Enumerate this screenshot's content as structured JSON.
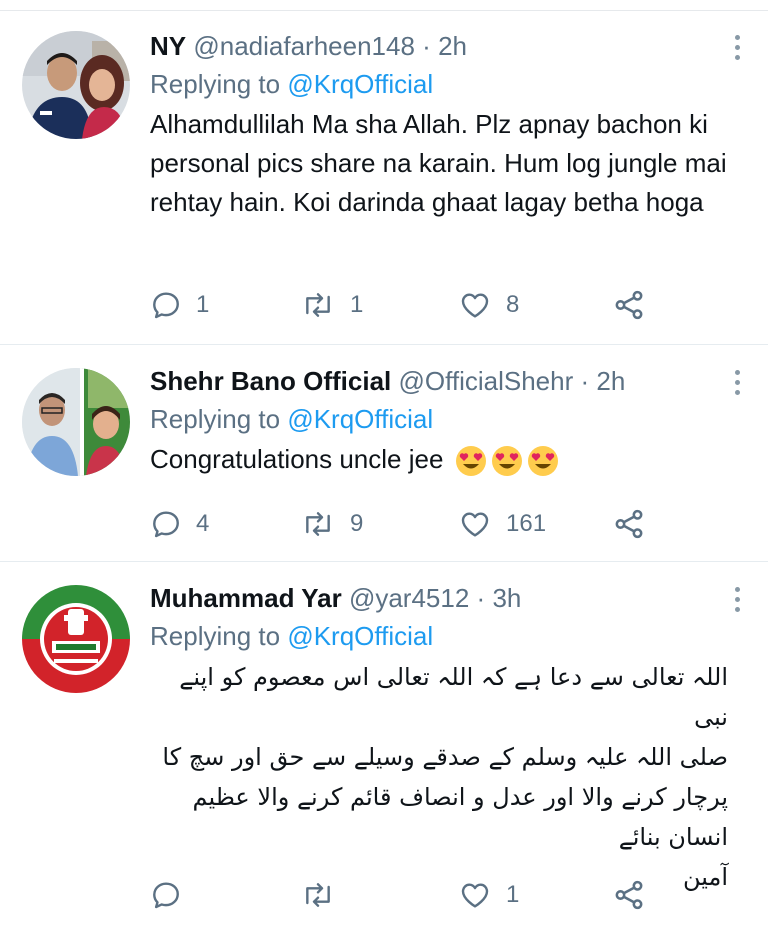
{
  "tweets": [
    {
      "name": "NY",
      "handle": "@nadiafarheen148",
      "separator": "·",
      "time": "2h",
      "replying_prefix": "Replying to",
      "replying_to": "@KrqOfficial",
      "text": "Alhamdullilah Ma sha Allah. Plz apnay bachon ki  personal pics share na karain. Hum log jungle mai rehtay hain. Koi darinda ghaat lagay betha hoga",
      "replies": "1",
      "retweets": "1",
      "likes": "8"
    },
    {
      "name": "Shehr Bano Official",
      "handle": "@OfficialShehr",
      "separator": "·",
      "time": "2h",
      "replying_prefix": "Replying to",
      "replying_to": "@KrqOfficial",
      "text": "Congratulations uncle jee",
      "emoji": [
        "smiling-face-heart-eyes",
        "smiling-face-heart-eyes",
        "smiling-face-heart-eyes"
      ],
      "replies": "4",
      "retweets": "9",
      "likes": "161"
    },
    {
      "name": "Muhammad Yar",
      "handle": "@yar4512",
      "separator": "·",
      "time": "3h",
      "replying_prefix": "Replying to",
      "replying_to": "@KrqOfficial",
      "text_lines": [
        "اللہ تعالی سے دعا ہے کہ اللہ تعالی اس معصوم کو اپنے نبی",
        "صلی اللہ علیہ وسلم کے صدقے وسیلے سے حق اور سچ کا",
        "پرچار کرنے والا اور عدل و انصاف قائم کرنے والا عظیم",
        "انسان بنائے",
        "آمین"
      ],
      "replies": "",
      "retweets": "",
      "likes": "1"
    }
  ],
  "colors": {
    "text": "#0f1419",
    "secondary": "#5b7083",
    "link": "#1d9bf0",
    "divider": "#e6ecf0"
  },
  "icons": [
    "reply-icon",
    "retweet-icon",
    "like-icon",
    "share-icon",
    "more-options-icon"
  ]
}
